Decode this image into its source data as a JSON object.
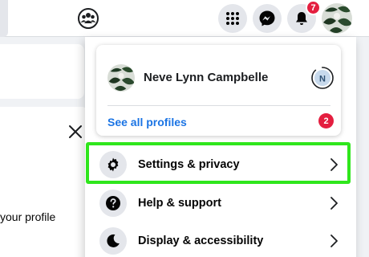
{
  "topbar": {
    "notifications_count": "7",
    "icons": [
      "groups-icon",
      "menu-grid-icon",
      "messenger-icon",
      "bell-icon"
    ]
  },
  "background": {
    "partial_text": "your profile"
  },
  "profile": {
    "name": "Neve Lynn Campbelle",
    "switch_initial": "N",
    "see_all_label": "See all profiles",
    "see_all_count": "2"
  },
  "menu": {
    "items": [
      {
        "label": "Settings & privacy",
        "icon": "gear-icon"
      },
      {
        "label": "Help & support",
        "icon": "question-icon"
      },
      {
        "label": "Display & accessibility",
        "icon": "moon-icon"
      }
    ]
  },
  "colors": {
    "accent": "#1b74e4",
    "badge": "#e41e3f",
    "highlight": "#2fe61c"
  }
}
